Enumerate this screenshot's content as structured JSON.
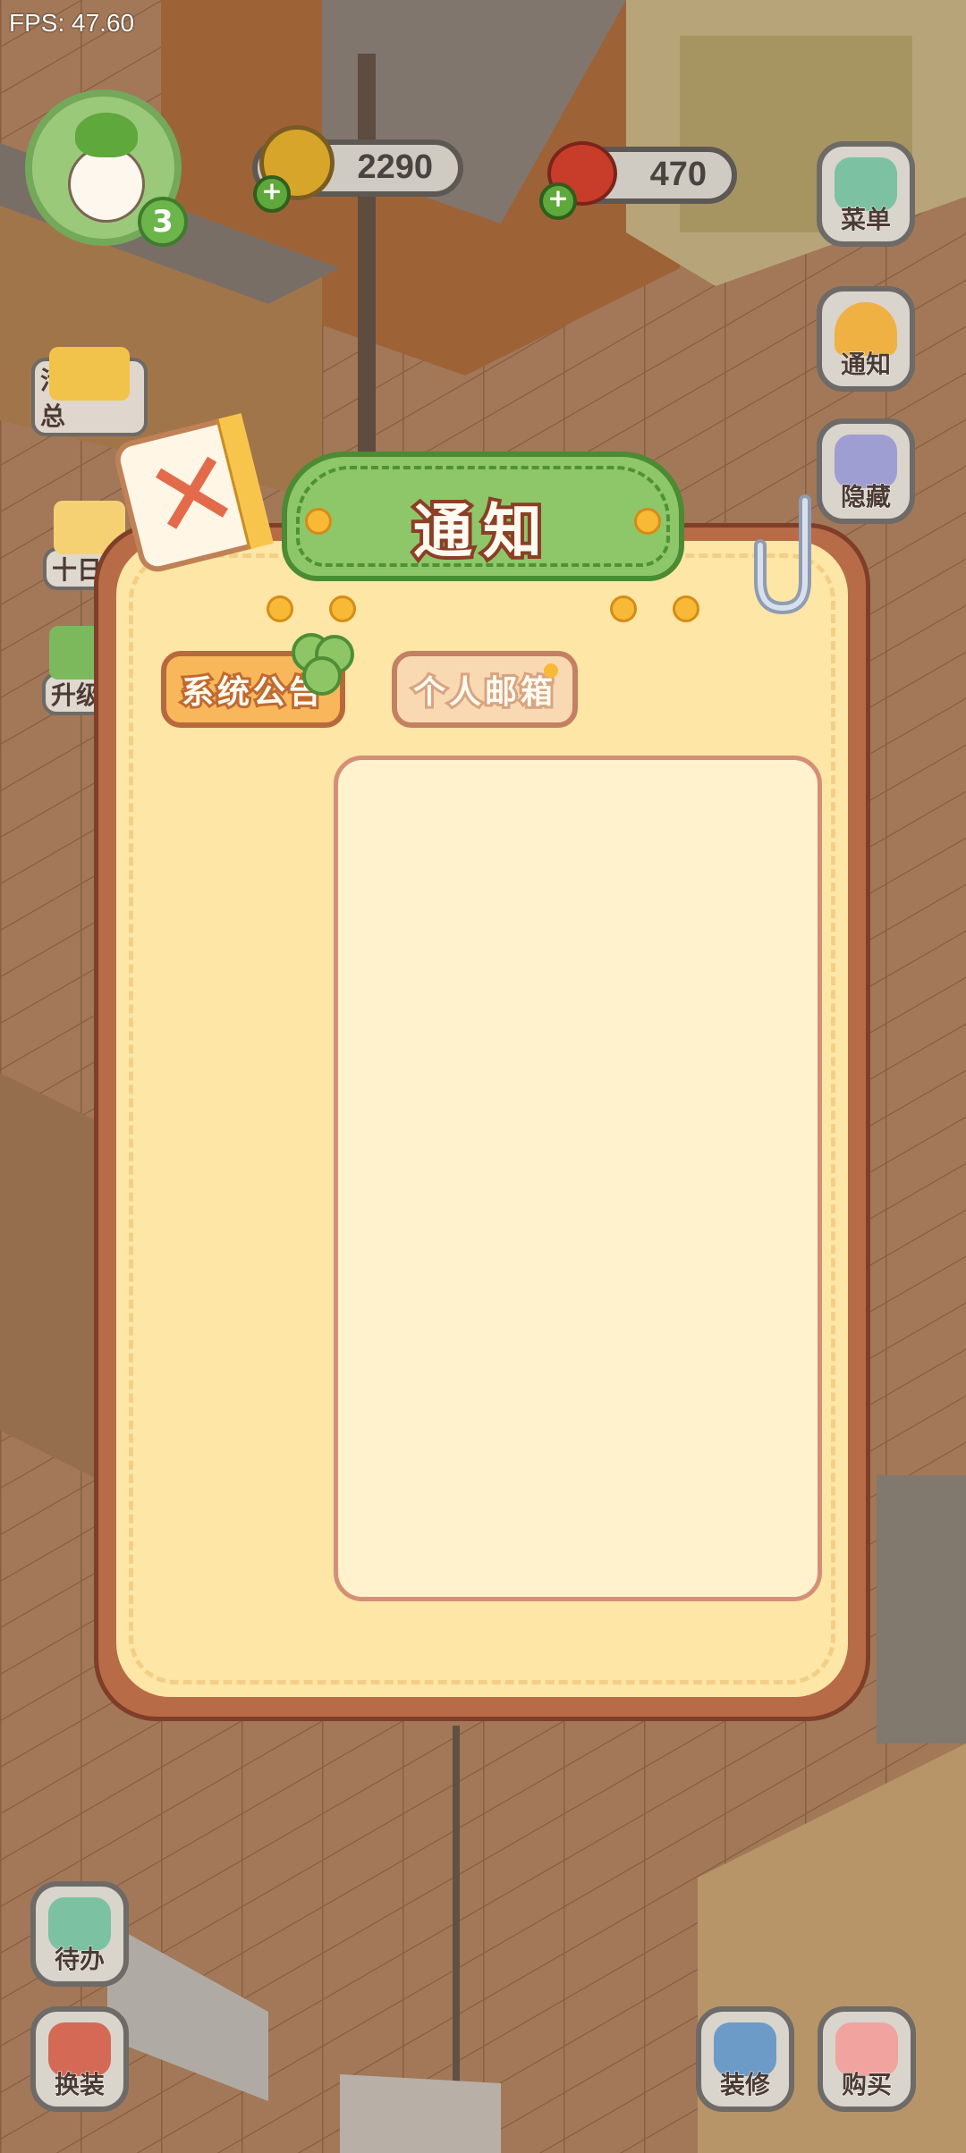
{
  "fps": "FPS: 47.60",
  "player": {
    "level": "3"
  },
  "currency": {
    "coins": "2290",
    "tomatoes": "470"
  },
  "right_menu": {
    "menu": "菜单",
    "notice": "通知",
    "hide": "隐藏"
  },
  "left_menu": {
    "events": "活动汇总",
    "ten_day": "十日签",
    "upgrade": "升级"
  },
  "bottom_left": {
    "todo": "待办",
    "dress": "换装"
  },
  "bottom_right": {
    "decorate": "装修",
    "buy": "购买"
  },
  "dialog": {
    "title": "通知",
    "tabs": [
      {
        "label": "系统公告",
        "active": true
      },
      {
        "label": "个人邮箱",
        "active": false
      }
    ]
  },
  "colors": {
    "panel_fill": "#fde6a6",
    "title_green": "#8ec66a",
    "accent_orange": "#f8b75b"
  }
}
